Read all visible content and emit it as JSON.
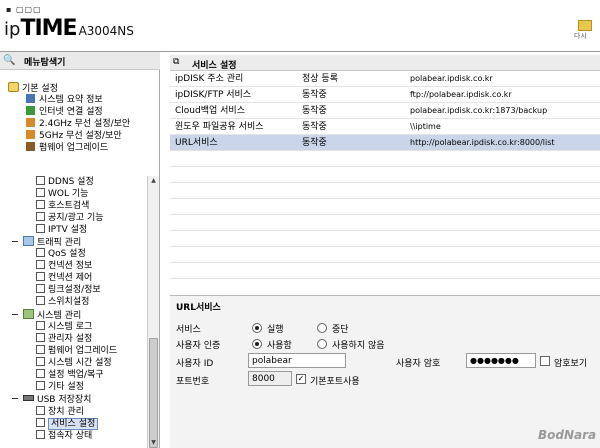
{
  "header": {
    "logo_dots": "▪ ▢▢▢",
    "logo_ip": "ip",
    "logo_time": "TIME",
    "logo_model": "A3004NS",
    "restart_label": "다시"
  },
  "sidebar": {
    "title": "메뉴탐색기",
    "groups_top": {
      "label": "기본 설정",
      "items": [
        "시스템 요약 정보",
        "인터넷 연결 설정",
        "2.4GHz 무선 설정/보안",
        "5GHz 무선 설정/보안",
        "펌웨어 업그레이드"
      ]
    },
    "advanced_items": [
      "DDNS 설정",
      "WOL 기능",
      "호스트검색",
      "공지/광고 기능",
      "IPTV 설정"
    ],
    "traffic": {
      "label": "트래픽 관리",
      "items": [
        "QoS 설정",
        "컨넥션 정보",
        "컨넥션 제어",
        "링크설정/정보",
        "스위치설정"
      ]
    },
    "system": {
      "label": "시스템 관리",
      "items": [
        "시스템 로그",
        "관리자 설정",
        "펌웨어 업그레이드",
        "시스템 시간 설정",
        "설정 백업/복구",
        "기타 설정"
      ]
    },
    "usb": {
      "label": "USB 저장장치",
      "items": [
        "장치 관리",
        "서비스 설정",
        "접속자 상태"
      ]
    }
  },
  "main": {
    "title": "서비스 설정",
    "services": [
      {
        "name": "ipDISK 주소 관리",
        "status": "정상 등록",
        "address": "polabear.ipdisk.co.kr"
      },
      {
        "name": "ipDISK/FTP 서비스",
        "status": "동작중",
        "address": "ftp://polabear.ipdisk.co.kr"
      },
      {
        "name": "Cloud백업 서비스",
        "status": "동작중",
        "address": "polabear.ipdisk.co.kr:1873/backup"
      },
      {
        "name": "윈도우 파일공유 서비스",
        "status": "동작중",
        "address": "\\\\iptime"
      },
      {
        "name": "URL서비스",
        "status": "동작중",
        "address": "http://polabear.ipdisk.co.kr:8000/list"
      }
    ]
  },
  "settings": {
    "title": "URL서비스",
    "service_label": "서비스",
    "run_label": "실행",
    "stop_label": "중단",
    "auth_label": "사용자 인증",
    "use_label": "사용함",
    "nouse_label": "사용하지 않음",
    "user_id_label": "사용자 ID",
    "user_id_value": "polabear",
    "password_label": "사용자 암호",
    "password_value": "●●●●●●●",
    "show_password_label": "암호보기",
    "port_label": "포트번호",
    "port_value": "8000",
    "default_port_label": "기본포트사용"
  },
  "watermark": "BodNara"
}
